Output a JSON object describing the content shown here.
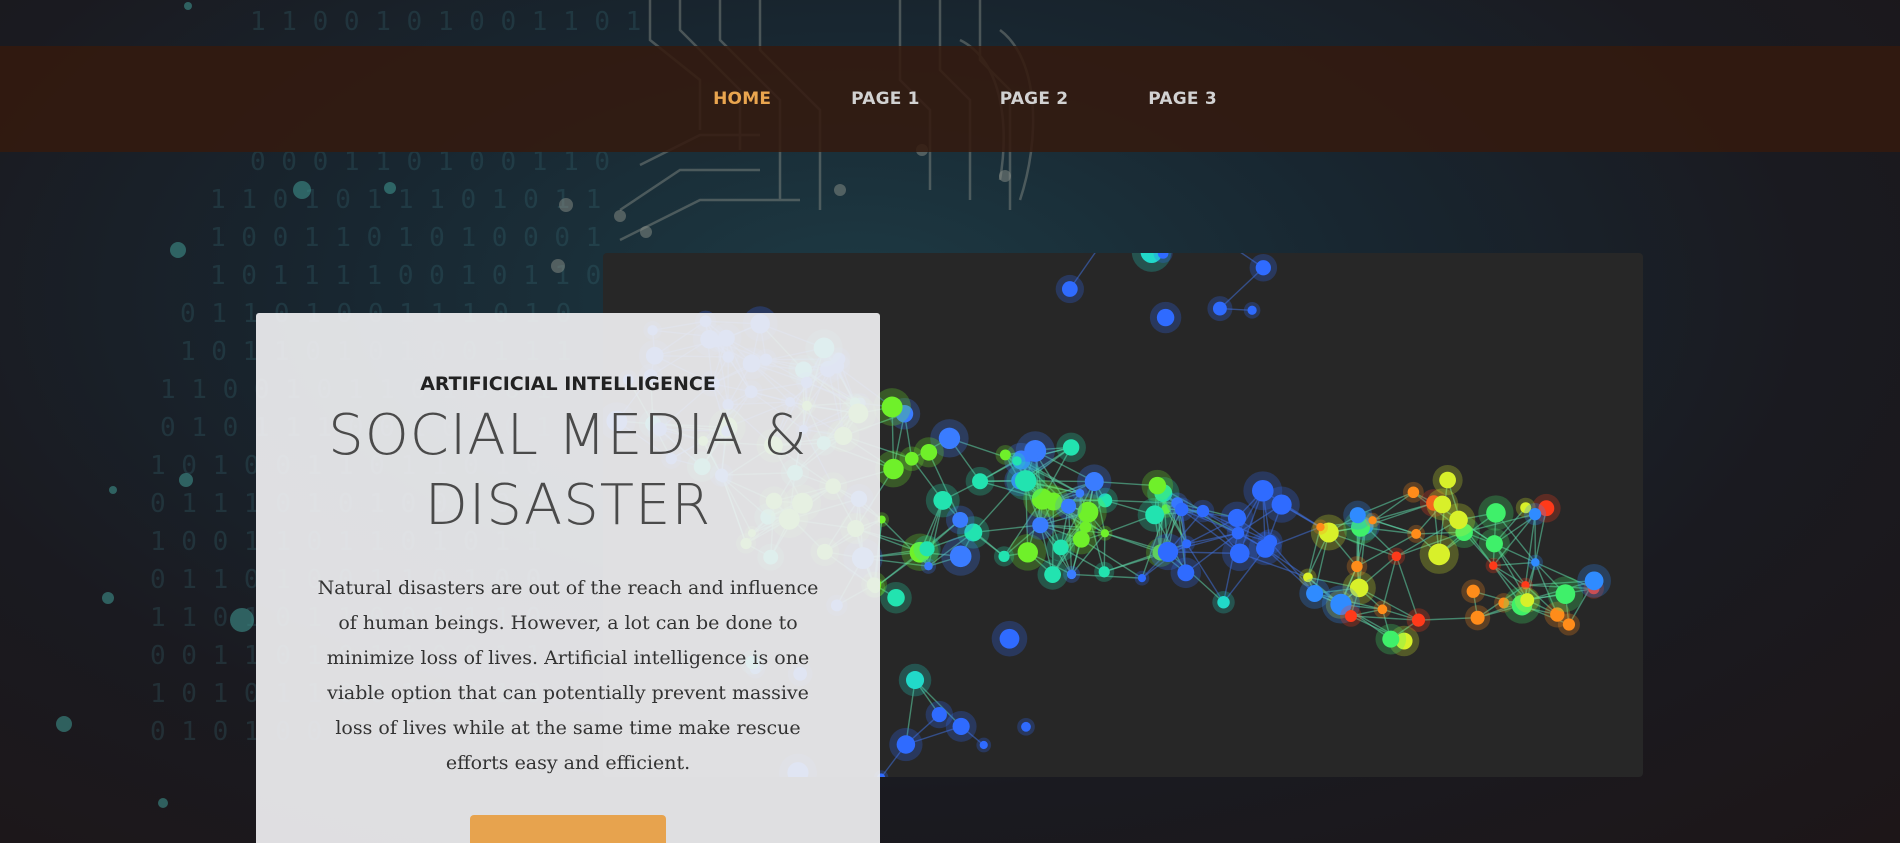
{
  "nav": {
    "items": [
      {
        "label": "HOME",
        "active": true
      },
      {
        "label": "PAGE 1",
        "active": false
      },
      {
        "label": "PAGE 2",
        "active": false
      },
      {
        "label": "PAGE 3",
        "active": false
      }
    ]
  },
  "hero": {
    "kicker": "ARTIFICICIAL INTELLIGENCE",
    "title_line1": "SOCIAL MEDIA &",
    "title_line2": "DISASTER",
    "body": "Natural disasters are out of the reach and influence of human beings. However, a lot can be done to minimize loss of lives. Artificial intelligence is one viable option that can potentially prevent massive loss of lives while at the same time make rescue efforts easy and efficient.",
    "button_label": ""
  },
  "colors": {
    "accent": "#e9a54f",
    "nav_bg": "#341a0e",
    "card_bg": "#f0f0f2",
    "panel_bg": "#272727"
  },
  "icons": {
    "image": "network-graph-image",
    "background": "circuit-binary-background"
  }
}
